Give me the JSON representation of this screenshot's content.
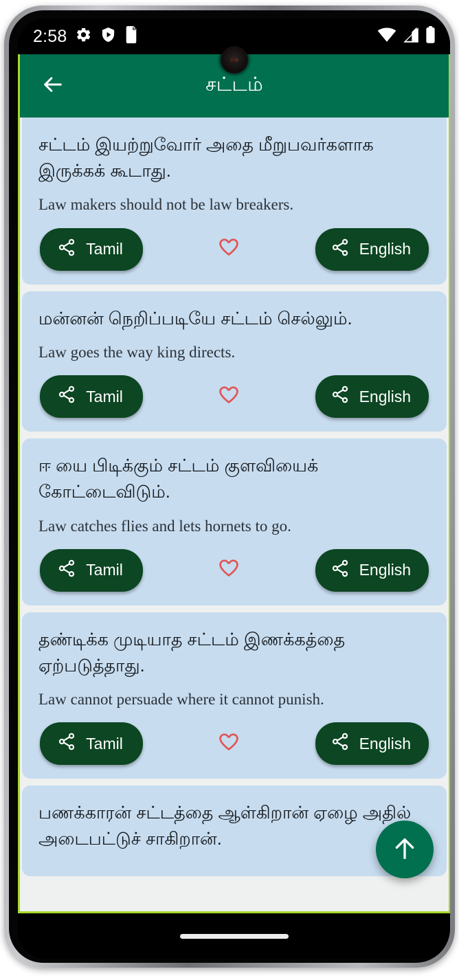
{
  "status_bar": {
    "time": "2:58",
    "left_icons": [
      "gear-icon",
      "play-protect-shield-icon",
      "sd-card-icon"
    ],
    "right_icons": [
      "wifi-icon",
      "cellular-signal-icon",
      "battery-icon"
    ]
  },
  "appbar": {
    "title": "சட்டம்",
    "back_icon": "back-arrow-icon",
    "background_color": "#00704F"
  },
  "colors": {
    "accent_green": "#00704F",
    "button_green": "#0C4622",
    "card_blue": "#C7DCEF",
    "page_background": "#EFF1F0",
    "favorite_red": "#E05555",
    "screen_border_lime": "#A6D92B"
  },
  "actions": {
    "tamil_share_label": "Tamil",
    "english_share_label": "English",
    "share_icon": "share-nodes-icon",
    "favorite_icon": "heart-outline-icon"
  },
  "fab": {
    "icon": "arrow-up-icon",
    "label": "Scroll to top"
  },
  "proverbs": [
    {
      "tamil": "சட்டம் இயற்றுவோர் அதை மீறுபவர்களாக இருக்கக் கூடாது.",
      "english": "Law makers should not be law breakers.",
      "favorited": false
    },
    {
      "tamil": "மன்னன் நெறிப்படியே சட்டம் செல்லும்.",
      "english": "Law goes the way king directs.",
      "favorited": false
    },
    {
      "tamil": "ஈ யை பிடிக்கும் சட்டம் குளவியைக் கோட்டைவிடும்.",
      "english": "Law catches flies and lets hornets to go.",
      "favorited": false
    },
    {
      "tamil": "தண்டிக்க முடியாத சட்டம் இணக்கத்தை ஏற்படுத்தாது.",
      "english": "Law cannot persuade where it cannot punish.",
      "favorited": false
    },
    {
      "tamil": "பணக்காரன் சட்டத்தை ஆள்கிறான் ஏழை அதில் அடைபட்டுச் சாகிறான்.",
      "english": "",
      "favorited": false
    }
  ]
}
